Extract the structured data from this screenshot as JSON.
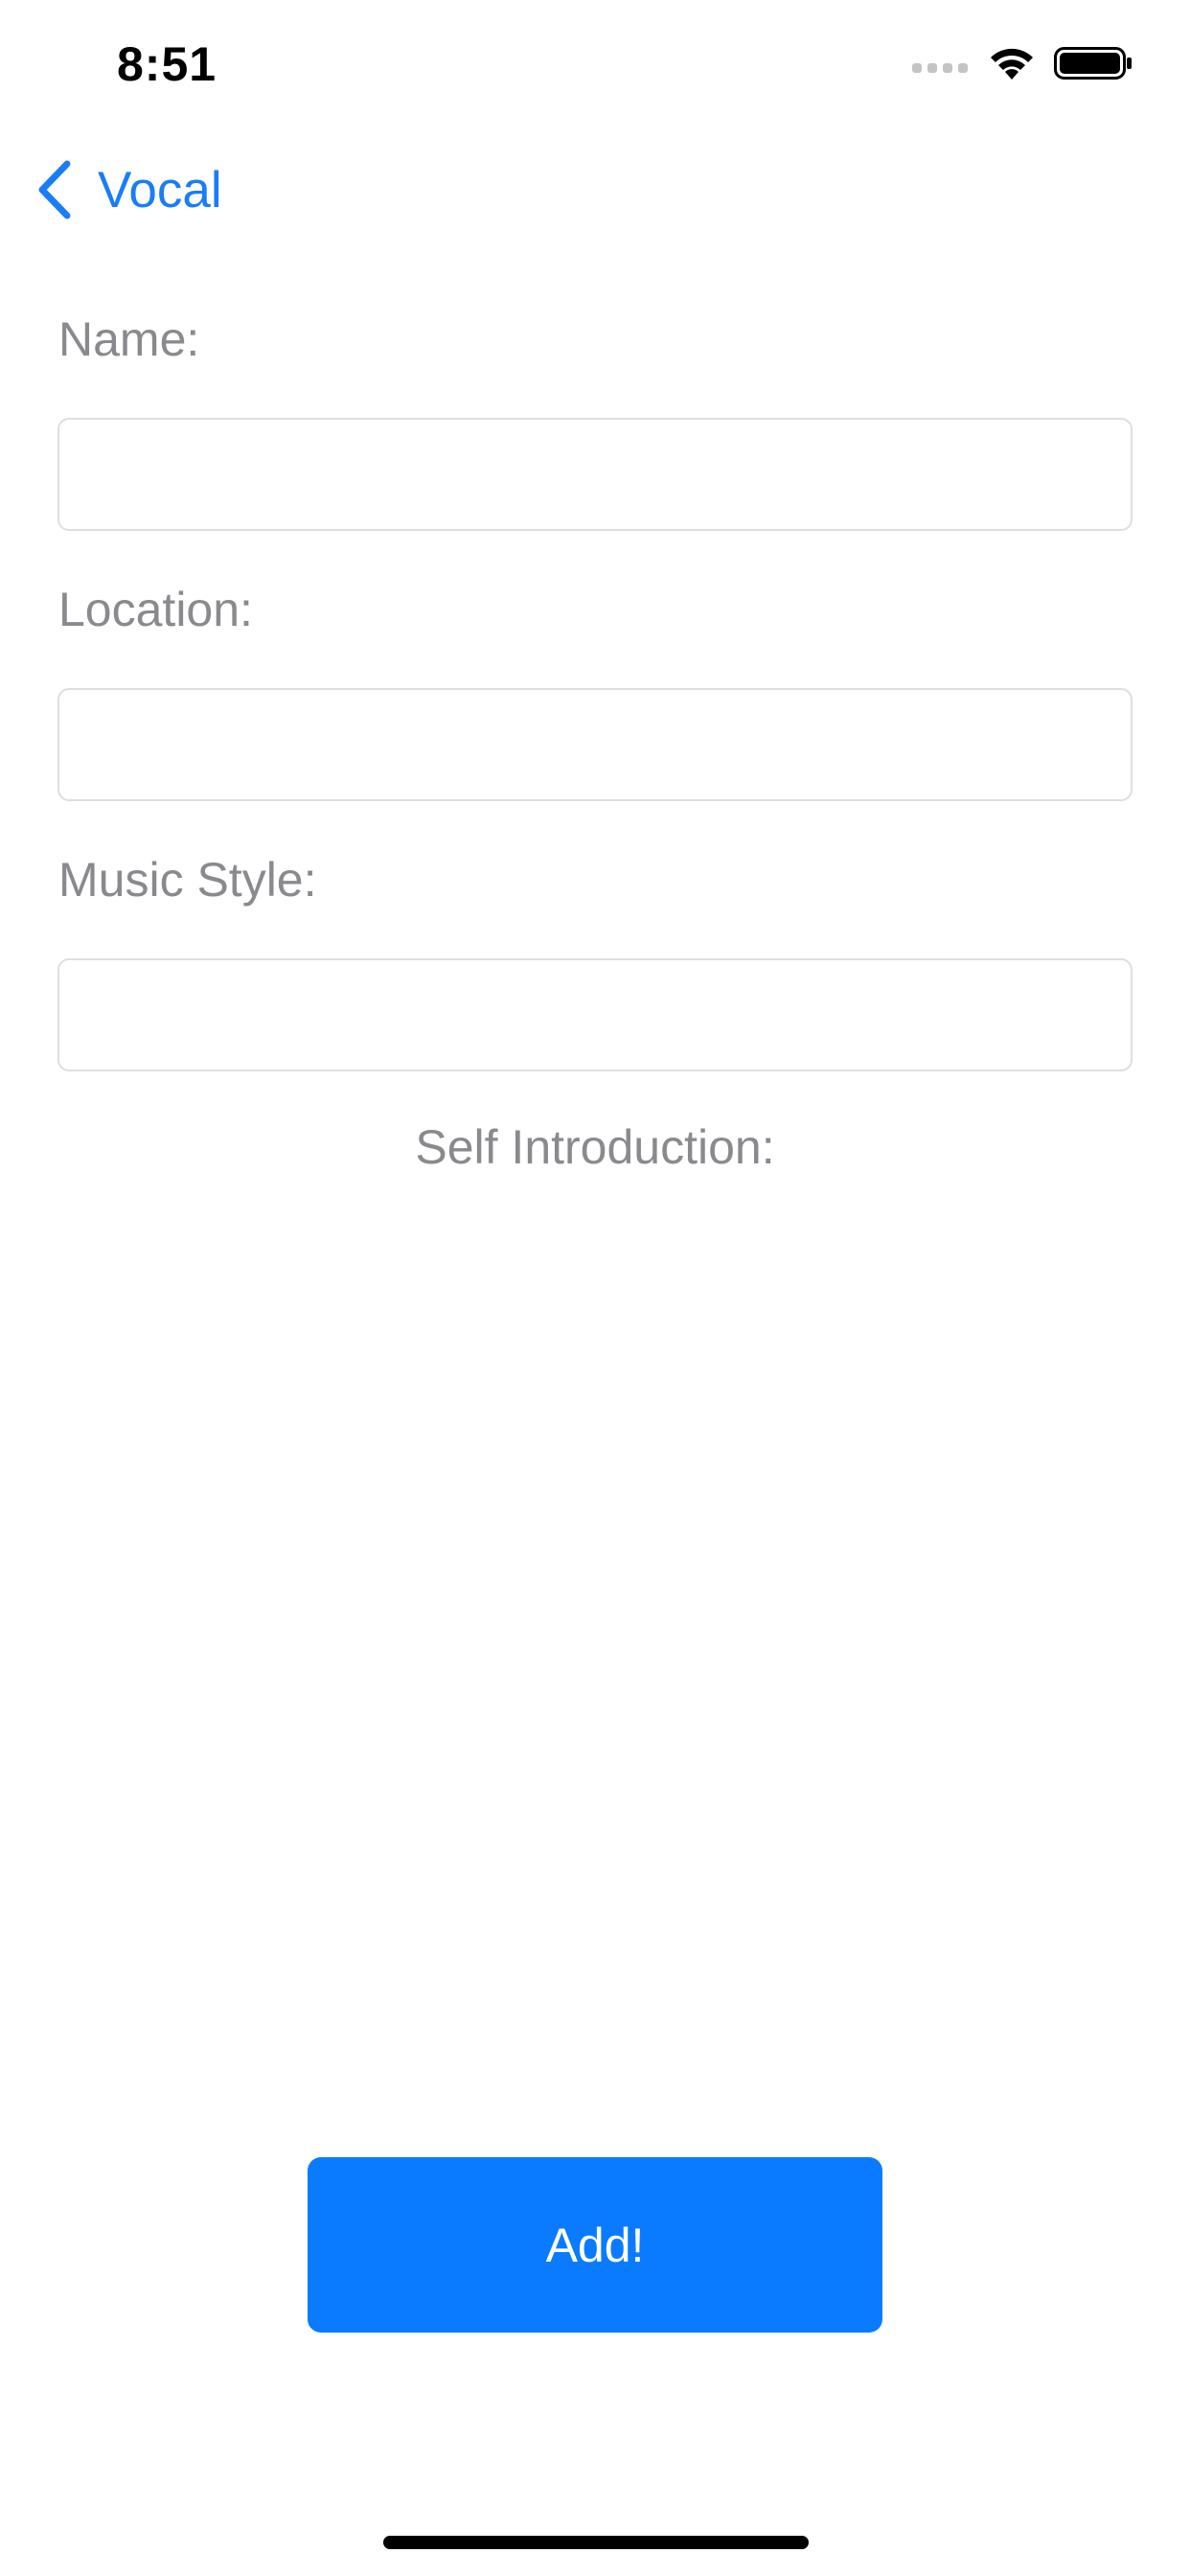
{
  "status_bar": {
    "time": "8:51"
  },
  "nav": {
    "back_label": "Vocal",
    "accent_color": "#1a7df7"
  },
  "form": {
    "name_label": "Name:",
    "name_value": "",
    "location_label": "Location:",
    "location_value": "",
    "music_style_label": "Music Style:",
    "music_style_value": "",
    "intro_label": "Self Introduction:",
    "intro_value": ""
  },
  "actions": {
    "add_label": "Add!",
    "add_color": "#0a7bfe"
  },
  "icons": {
    "signal": "cellular-signal-icon",
    "wifi": "wifi-icon",
    "battery": "battery-icon",
    "back": "chevron-left-icon"
  }
}
